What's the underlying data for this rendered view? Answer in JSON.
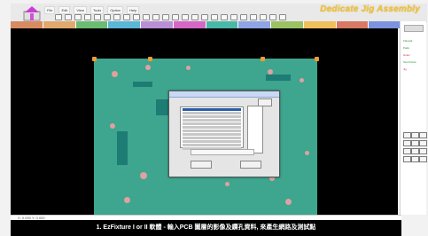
{
  "branding": {
    "title": "Dedicate Jig Assembly",
    "title_color": "#f0c340"
  },
  "menu": {
    "items": [
      "File",
      "Edit",
      "View",
      "Tools",
      "Option",
      "Help"
    ]
  },
  "toolbar": {
    "tool_count": 24
  },
  "layers": {
    "colors": [
      "#d78b61",
      "#e3a86d",
      "#69bc71",
      "#59b7d8",
      "#ba8fd6",
      "#d567c7",
      "#48b9a7",
      "#8ea4e6",
      "#9bc163",
      "#efc05b",
      "#d97864",
      "#7d93df"
    ]
  },
  "dialog": {
    "title": "Import",
    "list_rows": 12
  },
  "sidebar": {
    "labels": [
      "Fiducial",
      "Pads",
      "Holes",
      "Test Points",
      "Jig"
    ]
  },
  "status": {
    "text": "X: 0.000  Y: 0.000"
  },
  "caption": {
    "text": "1. EzFixture I or II 軟體 - 輸入PCB 圖層的影像及鑽孔資料, 來產生網路及測試點"
  }
}
